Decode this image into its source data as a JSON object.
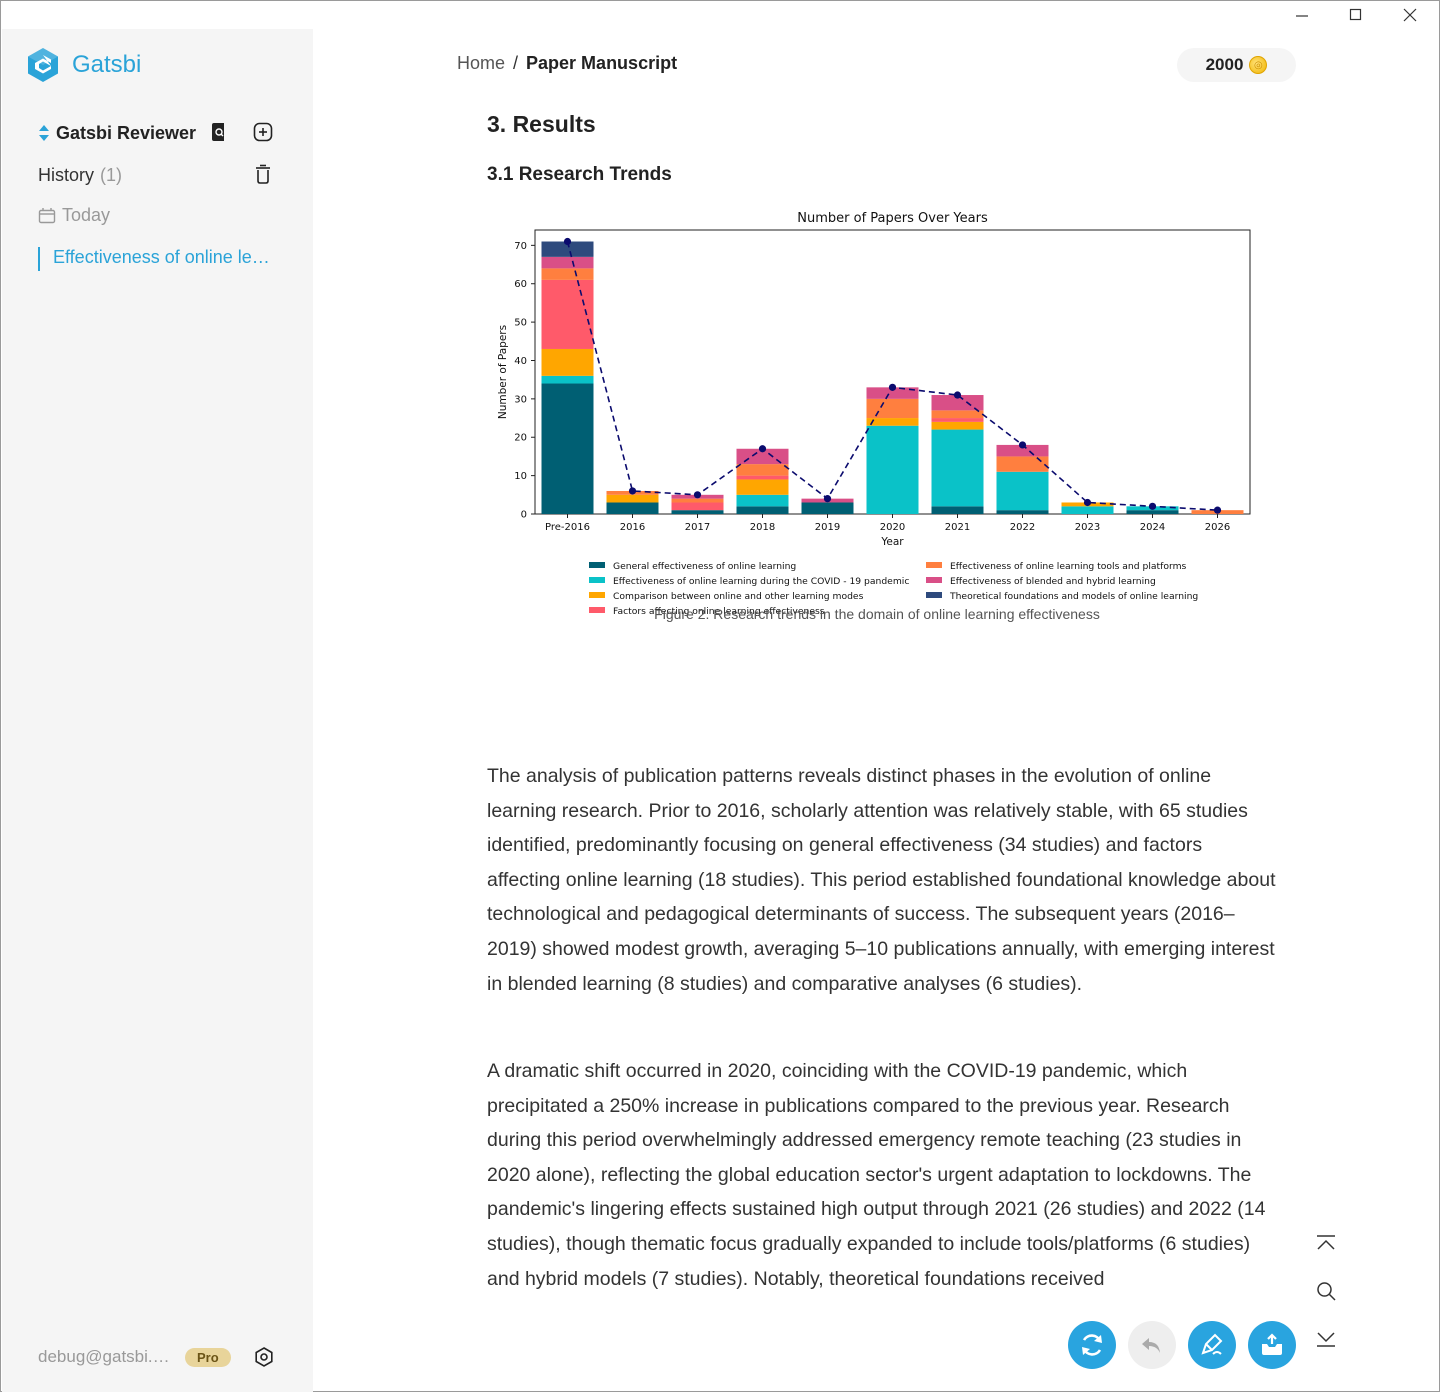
{
  "app": {
    "name": "Gatsbi",
    "brand_color": "#2aa3d8"
  },
  "window_controls": {
    "minimize": "minimize-icon",
    "maximize": "maximize-icon",
    "close": "close-icon"
  },
  "sidebar": {
    "workspace_label": "Gatsbi Reviewer",
    "history_label": "History",
    "history_count": "(1)",
    "today_label": "Today",
    "items": [
      {
        "label": "Effectiveness of online learning effectiveness"
      }
    ],
    "user_email": "debug@gatsbi.com",
    "plan_badge": "Pro"
  },
  "header": {
    "breadcrumb_home": "Home",
    "breadcrumb_sep": "/",
    "breadcrumb_current": "Paper Manuscript",
    "credits": "2000"
  },
  "document": {
    "section_title": "3. Results",
    "subsection_title": "3.1 Research Trends",
    "figure_caption": "Figure 2. Research trends in the domain of online learning effectiveness",
    "paragraph_1": "The analysis of publication patterns reveals distinct phases in the evolution of online learning research. Prior to 2016, scholarly attention was relatively stable, with 65 studies identified, predominantly focusing on general effectiveness (34 studies) and factors affecting online learning (18 studies). This period established foundational knowledge about technological and pedagogical determinants of success. The subsequent years (2016–2019) showed modest growth, averaging 5–10 publications annually, with emerging interest in blended learning (8 studies) and comparative analyses (6 studies).",
    "paragraph_2": "A dramatic shift occurred in 2020, coinciding with the COVID-19 pandemic, which precipitated a 250% increase in publications compared to the previous year. Research during this period overwhelmingly addressed emergency remote teaching (23 studies in 2020 alone), reflecting the global education sector's urgent adaptation to lockdowns. The pandemic's lingering effects sustained high output through 2021 (26 studies) and 2022 (14 studies), though thematic focus gradually expanded to include tools/platforms (6 studies) and hybrid models (7 studies). Notably, theoretical foundations received"
  },
  "chart_data": {
    "type": "bar",
    "stacked": true,
    "title": "Number of Papers Over Years",
    "xlabel": "Year",
    "ylabel": "Number of Papers",
    "ylim": [
      0,
      74
    ],
    "yticks": [
      0,
      10,
      20,
      30,
      40,
      50,
      60,
      70
    ],
    "grid": false,
    "legend_position": "bottom",
    "categories": [
      "Pre-2016",
      "2016",
      "2017",
      "2018",
      "2019",
      "2020",
      "2021",
      "2022",
      "2023",
      "2024",
      "2026"
    ],
    "series": [
      {
        "name": "General effectiveness of online learning",
        "color": "#005f73",
        "values": [
          34,
          3,
          1,
          2,
          3,
          0,
          2,
          1,
          0,
          1,
          0
        ]
      },
      {
        "name": "Effectiveness of online learning during the COVID - 19 pandemic",
        "color": "#0ac2c8",
        "values": [
          2,
          0,
          0,
          3,
          0,
          23,
          20,
          10,
          2,
          1,
          0
        ]
      },
      {
        "name": "Comparison between online and other learning modes",
        "color": "#ffa600",
        "values": [
          7,
          2,
          0,
          4,
          0,
          2,
          2,
          0,
          1,
          0,
          0
        ]
      },
      {
        "name": "Factors affecting online learning effectiveness",
        "color": "#ff5a6a",
        "values": [
          18,
          0,
          2,
          1,
          0,
          0,
          1,
          0,
          0,
          0,
          0
        ]
      },
      {
        "name": "Effectiveness of online learning tools and platforms",
        "color": "#ff7f3f",
        "values": [
          3,
          1,
          1,
          3,
          0,
          5,
          2,
          4,
          0,
          0,
          1
        ]
      },
      {
        "name": "Effectiveness of blended and hybrid learning",
        "color": "#d94f87",
        "values": [
          3,
          0,
          1,
          4,
          1,
          3,
          4,
          3,
          0,
          0,
          0
        ]
      },
      {
        "name": "Theoretical foundations and models of online learning",
        "color": "#2e4a7d",
        "values": [
          4,
          0,
          0,
          0,
          0,
          0,
          0,
          0,
          0,
          0,
          0
        ]
      }
    ],
    "totals_line": {
      "style": "dashed",
      "color": "#0b0b6e",
      "values": [
        71,
        6,
        5,
        17,
        4,
        33,
        31,
        18,
        3,
        2,
        1
      ]
    }
  },
  "floating_tools": {
    "scroll_up": "scroll-top-icon",
    "search": "search-icon",
    "scroll_down": "scroll-bottom-icon"
  },
  "actions": {
    "regenerate": "refresh-icon",
    "undo": "undo-icon",
    "edit": "edit-icon",
    "export": "export-icon"
  }
}
